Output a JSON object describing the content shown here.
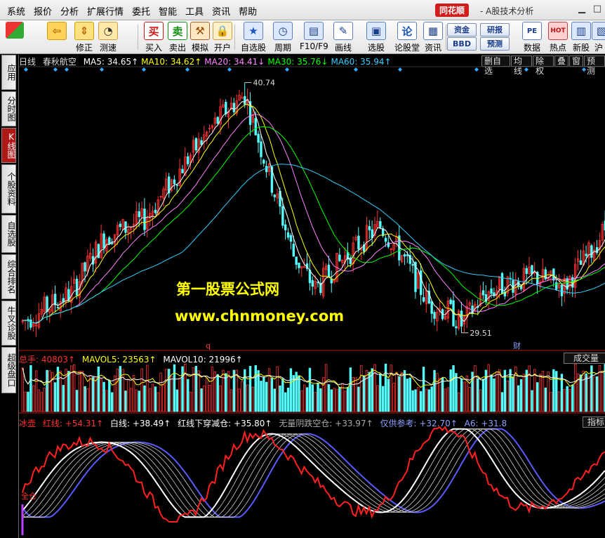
{
  "menubar": {
    "items": [
      "系统",
      "报价",
      "分析",
      "扩展行情",
      "委托",
      "智能",
      "工具",
      "资讯",
      "帮助"
    ],
    "brand": "同花顺",
    "app_title": "- A股技术分析"
  },
  "toolbar": {
    "buttons": [
      {
        "label": "",
        "icon": "grid-icon"
      },
      {
        "label": "",
        "icon": "back-arrow-icon"
      },
      {
        "label": "修正",
        "icon": "up-down-arrow-icon"
      },
      {
        "label": "测速",
        "icon": "speed-icon"
      },
      {
        "label": "买入",
        "icon_text": "买"
      },
      {
        "label": "卖出",
        "icon_text": "卖"
      },
      {
        "label": "模拟",
        "icon": "hammer-icon"
      },
      {
        "label": "开户",
        "icon": "lock-icon"
      },
      {
        "label": "自选股",
        "icon": "star-icon"
      },
      {
        "label": "周期",
        "icon": "clock-icon"
      },
      {
        "label": "F10/F9",
        "icon": "document-icon"
      },
      {
        "label": "画线",
        "icon": "pen-icon"
      },
      {
        "label": "选股",
        "icon": "filter-icon"
      },
      {
        "label": "论股堂",
        "icon_text": "论"
      },
      {
        "label": "资讯",
        "icon": "news-icon"
      },
      {
        "label": "数据",
        "icon_text": "PE"
      },
      {
        "label": "热点",
        "icon_text": "HOT"
      },
      {
        "label": "新股",
        "icon": "new-stock-icon"
      },
      {
        "label": "沪",
        "icon": "sh-icon"
      }
    ],
    "boxes": [
      "资金",
      "研报",
      "BBD",
      "预测"
    ]
  },
  "sidebar": {
    "tabs": [
      {
        "label": "应用",
        "active": false
      },
      {
        "label": "分时图",
        "active": false
      },
      {
        "label": "K线图",
        "active": true
      },
      {
        "label": "个股资料",
        "active": false
      },
      {
        "label": "自选股",
        "active": false
      },
      {
        "label": "综合排名",
        "active": false
      },
      {
        "label": "牛叉诊股",
        "active": false
      },
      {
        "label": "超级盘口",
        "active": false
      }
    ]
  },
  "kline": {
    "period": "日线",
    "stock_name": "春秋航空",
    "ma": [
      {
        "label": "MA5: 34.65↑",
        "color": "#ffffff"
      },
      {
        "label": "MA10: 34.62↑",
        "color": "#ffff00"
      },
      {
        "label": "MA20: 34.41↓",
        "color": "#ff80ff"
      },
      {
        "label": "MA30: 35.76↓",
        "color": "#00ff00"
      },
      {
        "label": "MA60: 35.94↑",
        "color": "#33ccff"
      }
    ],
    "right_buttons": [
      "删自选",
      "均线",
      "除权",
      "叠",
      "窗",
      "预测"
    ],
    "high_label": "40.74",
    "low_label": "29.51",
    "marker_q": "q",
    "marker_cai": "财",
    "colors": {
      "up": "#ff3232",
      "down": "#54fcfc",
      "bg": "#000000",
      "axis": "#b01818"
    }
  },
  "watermark": {
    "title": "第一股票公式网",
    "url": "www.chnmoney.com"
  },
  "volume": {
    "total_label": "总手: 40803↑",
    "mavol5": "MAVOL5: 23563↑",
    "mavol10": "MAVOL10: 21996↑",
    "right_label": "成交量"
  },
  "indicator": {
    "name": "冰壶",
    "red_line": "红线: +54.31↑",
    "white_line": "白线: +38.49↑",
    "cross_label": "红线下穿减仓: +35.80↑",
    "no_neg_label": "无量阴跌空仓: +33.97↑",
    "ref_label": "仅供参考: +32.70↑",
    "a6_label": "A6: +31.8",
    "right_label": "指标",
    "side_text": "全仓"
  }
}
